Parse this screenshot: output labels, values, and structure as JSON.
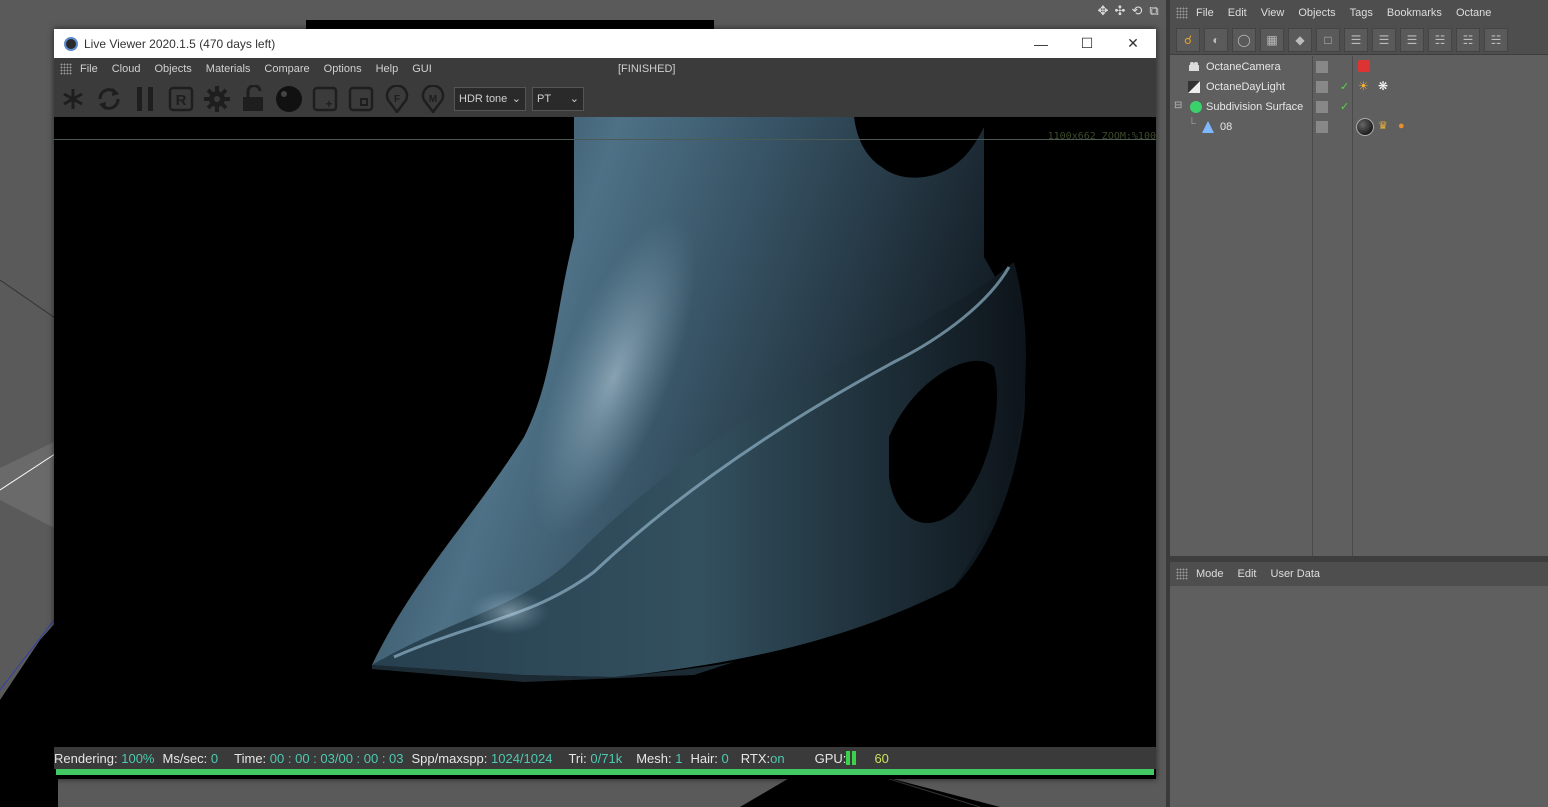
{
  "viewport": {
    "icons": [
      "move-icon",
      "pan-icon",
      "rotate-icon",
      "maximize-icon"
    ]
  },
  "live_viewer": {
    "title": "Live Viewer 2020.1.5 (470 days left)",
    "menu": [
      "File",
      "Cloud",
      "Objects",
      "Materials",
      "Compare",
      "Options",
      "Help",
      "GUI"
    ],
    "status": "[FINISHED]",
    "tonemap_select": "HDR tone",
    "kernel_select": "PT",
    "zoom_text": "1100x662 ZOOM:%100",
    "stats": {
      "rendering_label": "Rendering:",
      "rendering_value": "100%",
      "mssec_label": "Ms/sec:",
      "mssec_value": "0",
      "time_label": "Time:",
      "time_value": "00 : 00 : 03/00 : 00 : 03",
      "spp_label": "Spp/maxspp:",
      "spp_value": "1024/1024",
      "tri_label": "Tri:",
      "tri_value": "0/71k",
      "mesh_label": "Mesh:",
      "mesh_value": "1",
      "hair_label": "Hair:",
      "hair_value": "0",
      "rtx_label": "RTX:",
      "rtx_value": "on",
      "gpu_label": "GPU:",
      "gpu_value": "60"
    },
    "progress": 1.0
  },
  "object_manager": {
    "menu": [
      "File",
      "Edit",
      "View",
      "Objects",
      "Tags",
      "Bookmarks",
      "Octane"
    ],
    "objects": [
      {
        "name": "OctaneCamera"
      },
      {
        "name": "OctaneDayLight"
      },
      {
        "name": "Subdivision Surface"
      },
      {
        "name": "08"
      }
    ]
  },
  "attribute_manager": {
    "menu": [
      "Mode",
      "Edit",
      "User Data"
    ]
  },
  "colors": {
    "accent_green": "#43c964",
    "stat_value": "#4ec9b0"
  }
}
